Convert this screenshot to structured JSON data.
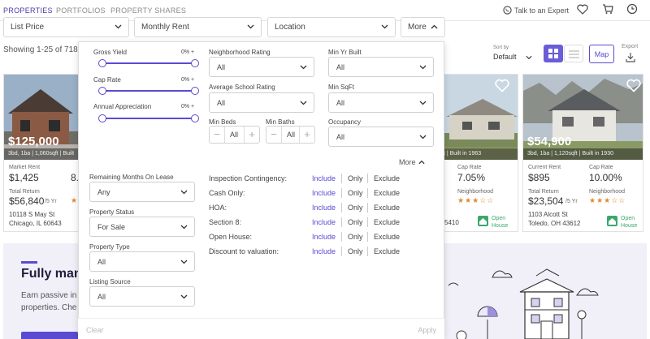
{
  "nav": {
    "tabs": [
      "PROPERTIES",
      "PORTFOLIOS",
      "PROPERTY SHARES"
    ],
    "talk": "Talk to an Expert"
  },
  "filters": {
    "list_price": "List Price",
    "monthly_rent": "Monthly Rent",
    "location": "Location",
    "more": "More"
  },
  "results": {
    "showing": "Showing 1-25 of 718"
  },
  "sort": {
    "label": "Sort by",
    "value": "Default"
  },
  "view": {
    "map": "Map",
    "export": "Export"
  },
  "cards": [
    {
      "price": "$125,000",
      "caption": "3bd, 1ba | 1,060sqft | Built",
      "rent_label": "Market Rent",
      "rent": "$1,425",
      "tr_label": "Total Return",
      "tr": "$56,840",
      "tr_unit": "/5 Yr",
      "addr1": "10118 S May St",
      "addr2": "Chicago, IL 60643",
      "cap_value": "8."
    },
    {
      "caption": "ft | Built in 1963",
      "cap_label": "Cap Rate",
      "cap": "7.05%",
      "nb_label": "Neighborhood",
      "stars": "★★★☆☆",
      "addr_frag": "5410",
      "oh": "Open House"
    },
    {
      "price": "$54,900",
      "caption": "3bd, 1ba | 1,120sqft | Built in 1930",
      "rent_label": "Current Rent",
      "rent": "$895",
      "cap_label": "Cap Rate",
      "cap": "10.00%",
      "tr_label": "Total Return",
      "tr": "$23,504",
      "tr_unit": "/5 Yr",
      "nb_label": "Neighborhood",
      "stars": "★★★☆☆",
      "addr1": "1103 Alcott St",
      "addr2": "Toledo, OH 43612",
      "oh": "Open House"
    }
  ],
  "banner": {
    "title": "Fully man",
    "line1": "Earn passive in",
    "line2": "properties. Che"
  },
  "panel": {
    "sliders": [
      {
        "label": "Gross Yield",
        "value": "0% +"
      },
      {
        "label": "Cap Rate",
        "value": "0% +"
      },
      {
        "label": "Annual Appreciation",
        "value": "0% +"
      }
    ],
    "neigh_label": "Neighborhood Rating",
    "neigh": "All",
    "school_label": "Average School Rating",
    "school": "All",
    "minyr_label": "Min Yr Built",
    "minyr": "All",
    "minsqft_label": "Min SqFt",
    "minsqft": "All",
    "beds_label": "Min Beds",
    "beds": "All",
    "baths_label": "Min Baths",
    "baths": "All",
    "occ_label": "Occupancy",
    "occ": "All",
    "more": "More",
    "months_label": "Remaining Months On Lease",
    "months": "Any",
    "status_label": "Property Status",
    "status": "For Sale",
    "type_label": "Property Type",
    "type": "All",
    "source_label": "Listing Source",
    "source": "All",
    "toggles": [
      "Inspection Contingency:",
      "Cash Only:",
      "HOA:",
      "Section 8:",
      "Open House:",
      "Discount to valuation:"
    ],
    "opt_include": "Include",
    "opt_only": "Only",
    "opt_exclude": "Exclude",
    "clear": "Clear",
    "apply": "Apply"
  }
}
